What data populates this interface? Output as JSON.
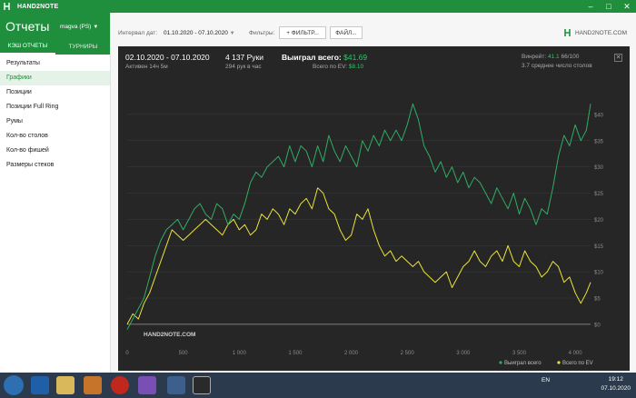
{
  "app": {
    "title": "HAND2NOTE"
  },
  "sidebar": {
    "title": "Отчеты",
    "account": "magva (PS)",
    "tabs": [
      {
        "label": "КЭШ ОТЧЕТЫ",
        "active": true
      },
      {
        "label": "ТУРНИРЫ",
        "active": false
      }
    ],
    "items": [
      {
        "label": "Результаты",
        "active": false
      },
      {
        "label": "Графики",
        "active": true
      },
      {
        "label": "Позиции",
        "active": false
      },
      {
        "label": "Позиции Full Ring",
        "active": false
      },
      {
        "label": "Румы",
        "active": false
      },
      {
        "label": "Кол-во столов",
        "active": false
      },
      {
        "label": "Кол-во фишей",
        "active": false
      },
      {
        "label": "Размеры стеков",
        "active": false
      }
    ]
  },
  "toolbar": {
    "interval_label": "Интервал дат:",
    "interval_value": "01.10.2020 - 07.10.2020",
    "filters_label": "Фильтры:",
    "filter_button": "+ ФИЛЬТР...",
    "file_button": "ФАЙЛ...",
    "brand": "HAND2NOTE.COM"
  },
  "stats": {
    "date_range": "02.10.2020 - 07.10.2020",
    "active_time": "Активен 14ч 5м",
    "hands": "4 137 Руки",
    "hands_per_hour": "294 рук в час",
    "total_won_label": "Выиграл всего:",
    "total_won_value": "$41.69",
    "ev_label": "Всего по EV:",
    "ev_value": "$8.10",
    "winrate_label": "Винрейт:",
    "winrate_value": "41.1",
    "winrate_of": "66/100",
    "tables": "3.7 среднее число столов"
  },
  "watermark": "HAND2NOTE.COM",
  "colors": {
    "won": "#2fae63",
    "ev": "#e9e33a",
    "accent": "#1f8f3e"
  },
  "chart_data": {
    "type": "line",
    "x_ticks": [
      "0",
      "500",
      "1 000",
      "1 500",
      "2 000",
      "2 500",
      "3 000",
      "3 500",
      "4 000"
    ],
    "y_ticks": [
      "$0",
      "$5",
      "$10",
      "$15",
      "$20",
      "$25",
      "$30",
      "$35",
      "$40"
    ],
    "xlim": [
      0,
      4137
    ],
    "ylim": [
      -4,
      45
    ],
    "grid": true,
    "legend_position": "bottom-right",
    "series": [
      {
        "name": "Выиграл всего",
        "color": "#2fae63",
        "x": [
          0,
          50,
          100,
          150,
          200,
          250,
          300,
          350,
          400,
          450,
          500,
          550,
          600,
          650,
          700,
          750,
          800,
          850,
          900,
          950,
          1000,
          1050,
          1100,
          1150,
          1200,
          1250,
          1300,
          1350,
          1400,
          1450,
          1500,
          1550,
          1600,
          1650,
          1700,
          1750,
          1800,
          1850,
          1900,
          1950,
          2000,
          2050,
          2100,
          2150,
          2200,
          2250,
          2300,
          2350,
          2400,
          2450,
          2500,
          2550,
          2600,
          2650,
          2700,
          2750,
          2800,
          2850,
          2900,
          2950,
          3000,
          3050,
          3100,
          3150,
          3200,
          3250,
          3300,
          3350,
          3400,
          3450,
          3500,
          3550,
          3600,
          3650,
          3700,
          3750,
          3800,
          3850,
          3900,
          3950,
          4000,
          4050,
          4100,
          4137
        ],
        "y": [
          -1,
          1,
          3,
          5,
          9,
          13,
          16,
          18,
          19,
          20,
          18,
          20,
          22,
          23,
          21,
          20,
          23,
          22,
          19,
          21,
          20,
          23,
          27,
          29,
          28,
          30,
          31,
          32,
          30,
          34,
          31,
          34,
          33,
          30,
          34,
          31,
          36,
          33,
          31,
          34,
          32,
          30,
          35,
          33,
          36,
          34,
          37,
          35,
          37,
          35,
          38,
          42,
          39,
          34,
          32,
          29,
          31,
          28,
          30,
          27,
          29,
          26,
          28,
          27,
          25,
          23,
          26,
          24,
          22,
          25,
          21,
          24,
          22,
          19,
          22,
          21,
          26,
          32,
          36,
          34,
          38,
          35,
          37,
          42
        ]
      },
      {
        "name": "Всего по EV",
        "color": "#e9e33a",
        "x": [
          0,
          50,
          100,
          150,
          200,
          250,
          300,
          350,
          400,
          450,
          500,
          550,
          600,
          650,
          700,
          750,
          800,
          850,
          900,
          950,
          1000,
          1050,
          1100,
          1150,
          1200,
          1250,
          1300,
          1350,
          1400,
          1450,
          1500,
          1550,
          1600,
          1650,
          1700,
          1750,
          1800,
          1850,
          1900,
          1950,
          2000,
          2050,
          2100,
          2150,
          2200,
          2250,
          2300,
          2350,
          2400,
          2450,
          2500,
          2550,
          2600,
          2650,
          2700,
          2750,
          2800,
          2850,
          2900,
          2950,
          3000,
          3050,
          3100,
          3150,
          3200,
          3250,
          3300,
          3350,
          3400,
          3450,
          3500,
          3550,
          3600,
          3650,
          3700,
          3750,
          3800,
          3850,
          3900,
          3950,
          4000,
          4050,
          4100,
          4137
        ],
        "y": [
          0,
          2,
          1,
          4,
          6,
          9,
          12,
          15,
          18,
          17,
          16,
          17,
          18,
          19,
          20,
          19,
          18,
          17,
          19,
          20,
          18,
          19,
          17,
          18,
          21,
          20,
          22,
          21,
          19,
          22,
          21,
          23,
          24,
          22,
          26,
          25,
          22,
          21,
          18,
          16,
          17,
          21,
          20,
          22,
          18,
          15,
          13,
          14,
          12,
          13,
          12,
          11,
          12,
          10,
          9,
          8,
          9,
          10,
          7,
          9,
          11,
          12,
          14,
          12,
          11,
          13,
          14,
          12,
          15,
          12,
          11,
          14,
          12,
          11,
          9,
          10,
          12,
          11,
          8,
          9,
          6,
          4,
          6,
          8
        ]
      }
    ]
  }
}
